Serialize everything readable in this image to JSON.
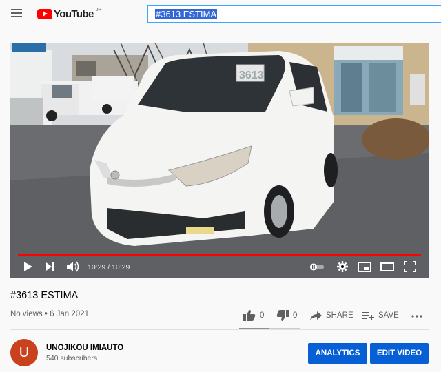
{
  "header": {
    "logo_text": "YouTube",
    "logo_region": "JP",
    "search_value": "#3613 ESTIMA"
  },
  "player": {
    "time_display": "10:29 / 10:29",
    "progress_fraction": 1.0,
    "plate_text": "3613"
  },
  "video": {
    "title": "#3613 ESTIMA",
    "meta": "No views • 6 Jan 2021",
    "like_count": "0",
    "dislike_count": "0",
    "share_label": "SHARE",
    "save_label": "SAVE"
  },
  "channel": {
    "avatar_letter": "U",
    "name": "UNOJIKOU IMIAUTO",
    "subscribers": "540 subscribers"
  },
  "buttons": {
    "analytics": "ANALYTICS",
    "edit_video": "EDIT VIDEO"
  },
  "colors": {
    "accent": "#065fd4",
    "progress": "#ff0000",
    "avatar": "#c9411d"
  }
}
